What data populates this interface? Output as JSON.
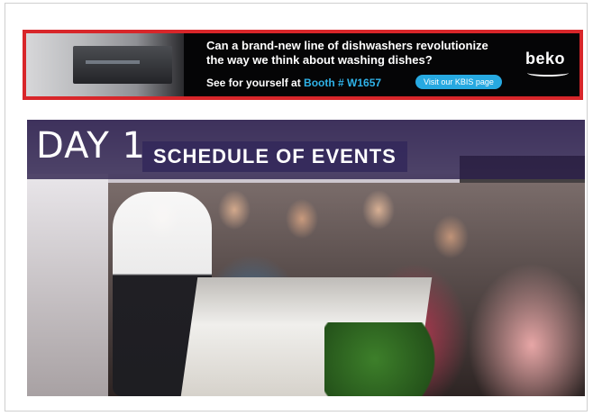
{
  "banner": {
    "headline_line1": "Can a brand-new line of dishwashers revolutionize",
    "headline_line2": "the way we think about washing dishes?",
    "cta_prefix": "See for yourself at ",
    "cta_booth": "Booth # W1657",
    "button_label": "Visit our KBIS page",
    "brand": "beko",
    "colors": {
      "border": "#d8262a",
      "background": "#050506",
      "accent": "#27a9e1"
    }
  },
  "hero": {
    "day_label": "DAY 1",
    "title": "SCHEDULE OF EVENTS",
    "colors": {
      "band": "#2b1e4a"
    }
  }
}
